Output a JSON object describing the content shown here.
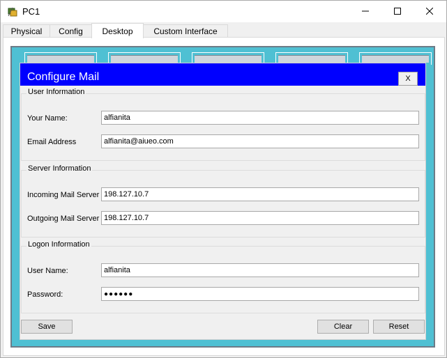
{
  "window": {
    "title": "PC1",
    "controls": {
      "minimize_icon": "minimize-icon",
      "maximize_icon": "maximize-icon",
      "close_icon": "close-icon"
    }
  },
  "tabs": [
    {
      "label": "Physical",
      "active": false
    },
    {
      "label": "Config",
      "active": false
    },
    {
      "label": "Desktop",
      "active": true
    },
    {
      "label": "Custom Interface",
      "active": false
    }
  ],
  "dialog": {
    "title": "Configure Mail",
    "close_label": "X",
    "user_information": {
      "legend": "User Information",
      "your_name_label": "Your Name:",
      "your_name_value": "alfianita",
      "email_label": "Email Address",
      "email_value": "alfianita@aiueo.com"
    },
    "server_information": {
      "legend": "Server Information",
      "incoming_label": "Incoming Mail Server",
      "incoming_value": "198.127.10.7",
      "outgoing_label": "Outgoing Mail Server",
      "outgoing_value": "198.127.10.7"
    },
    "logon_information": {
      "legend": "Logon Information",
      "username_label": "User Name:",
      "username_value": "alfianita",
      "password_label": "Password:",
      "password_value": "●●●●●●"
    },
    "buttons": {
      "save": "Save",
      "clear": "Clear",
      "reset": "Reset"
    }
  },
  "colors": {
    "dialog_titlebar": "#0000ff",
    "desktop_background": "#4fc0d3"
  }
}
